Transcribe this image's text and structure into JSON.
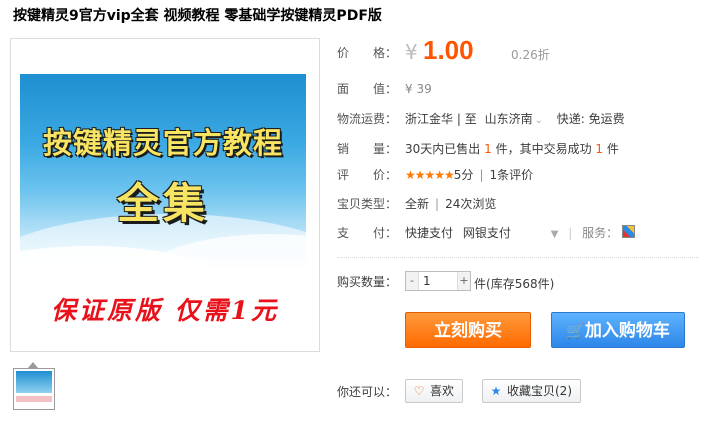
{
  "title": "按键精灵9官方vip全套 视频教程 零基础学按键精灵PDF版",
  "banner": {
    "line1": "按键精灵官方教程",
    "line2": "全集",
    "promo": "保证原版 仅需1元"
  },
  "price": {
    "label": "价　　格：",
    "currency": "¥",
    "value": "1.00",
    "discount": "0.26折"
  },
  "face_value": {
    "label": "面　　值：",
    "value": "¥ 39"
  },
  "shipping": {
    "label": "物流运费：",
    "from": "浙江金华",
    "sep1": "|",
    "to_label": "至",
    "to": "山东济南",
    "arrow": "⌄",
    "fee": "快递: 免运费"
  },
  "sales": {
    "label": "销　　量：",
    "prefix": "30天内已售出",
    "count": "1",
    "mid": "件，其中交易成功",
    "success": "1",
    "suffix": "件"
  },
  "rating": {
    "label": "评　　价：",
    "stars": "★★★★★",
    "score": "5分",
    "sep": "|",
    "reviews": "1条评价"
  },
  "item_type": {
    "label": "宝贝类型：",
    "condition": "全新",
    "sep": "|",
    "views": "24次浏览"
  },
  "payment": {
    "label": "支　　付：",
    "method1": "快捷支付",
    "method2": "网银支付",
    "service_label": "服务："
  },
  "quantity": {
    "label": "购买数量：",
    "minus": "-",
    "value": "1",
    "plus": "+",
    "unit": "件",
    "stock": "(库存568件)"
  },
  "buttons": {
    "buy_now": "立刻购买",
    "add_cart": "加入购物车",
    "cart_icon": "🛒"
  },
  "actions": {
    "label": "你还可以：",
    "like": "喜欢",
    "like_icon": "♡",
    "favorite": "收藏宝贝(2)",
    "favorite_icon": "★"
  },
  "colors": {
    "price_orange": "#ff5500",
    "buy_orange": "#ff6a00",
    "cart_blue": "#2d87e8"
  }
}
